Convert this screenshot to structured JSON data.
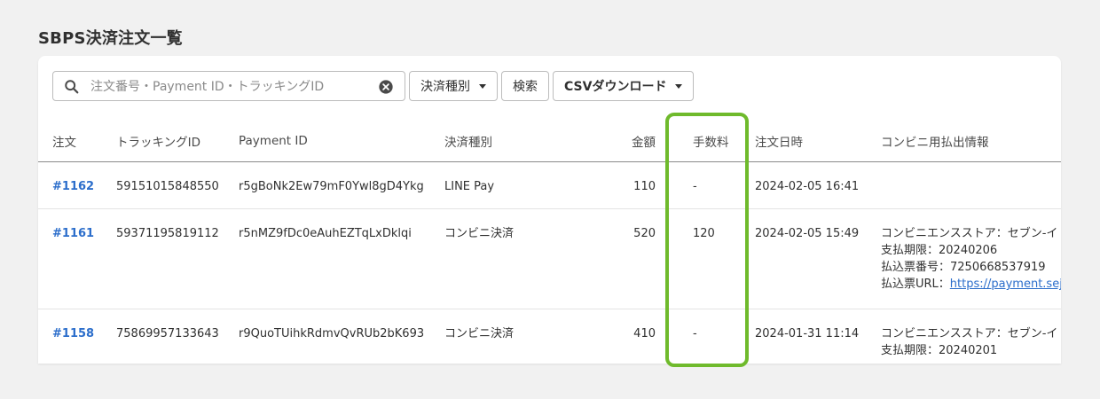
{
  "page": {
    "title": "SBPS決済注文一覧"
  },
  "toolbar": {
    "search_placeholder": "注文番号・Payment ID・トラッキングID",
    "payment_type_button": "決済種別",
    "search_button": "検索",
    "csv_button": "CSVダウンロード"
  },
  "table": {
    "headers": [
      "注文",
      "トラッキングID",
      "Payment ID",
      "決済種別",
      "金額",
      "手数料",
      "注文日時",
      "コンビニ用払出情報"
    ],
    "rows": [
      {
        "order": "#1162",
        "tracking_id": "59151015848550",
        "payment_id": "r5gBoNk2Ew79mF0Ywl8gD4Ykg",
        "payment_type": "LINE Pay",
        "amount": "110",
        "fee": "-",
        "datetime": "2024-02-05 16:41",
        "info": []
      },
      {
        "order": "#1161",
        "tracking_id": "59371195819112",
        "payment_id": "r5nMZ9fDc0eAuhEZTqLxDklqi",
        "payment_type": "コンビニ決済",
        "amount": "520",
        "fee": "120",
        "datetime": "2024-02-05 15:49",
        "info": [
          "コンビニエンスストア：セブン-イ",
          "支払期限：20240206",
          "払込票番号：7250668537919"
        ],
        "info_url_label": "払込票URL：",
        "info_url": "https://payment.sej."
      },
      {
        "order": "#1158",
        "tracking_id": "75869957133643",
        "payment_id": "r9QuoTUihkRdmvQvRUb2bK693",
        "payment_type": "コンビニ決済",
        "amount": "410",
        "fee": "-",
        "datetime": "2024-01-31 11:14",
        "info": [
          "コンビニエンスストア：セブン-イ",
          "支払期限：20240201"
        ]
      }
    ]
  },
  "colors": {
    "highlight": "#6fba2c",
    "link": "#2c6ecb",
    "background": "#f1f1f1"
  },
  "icons": {
    "search": "search-icon",
    "clear": "clear-icon",
    "caret": "chevron-down-icon"
  }
}
